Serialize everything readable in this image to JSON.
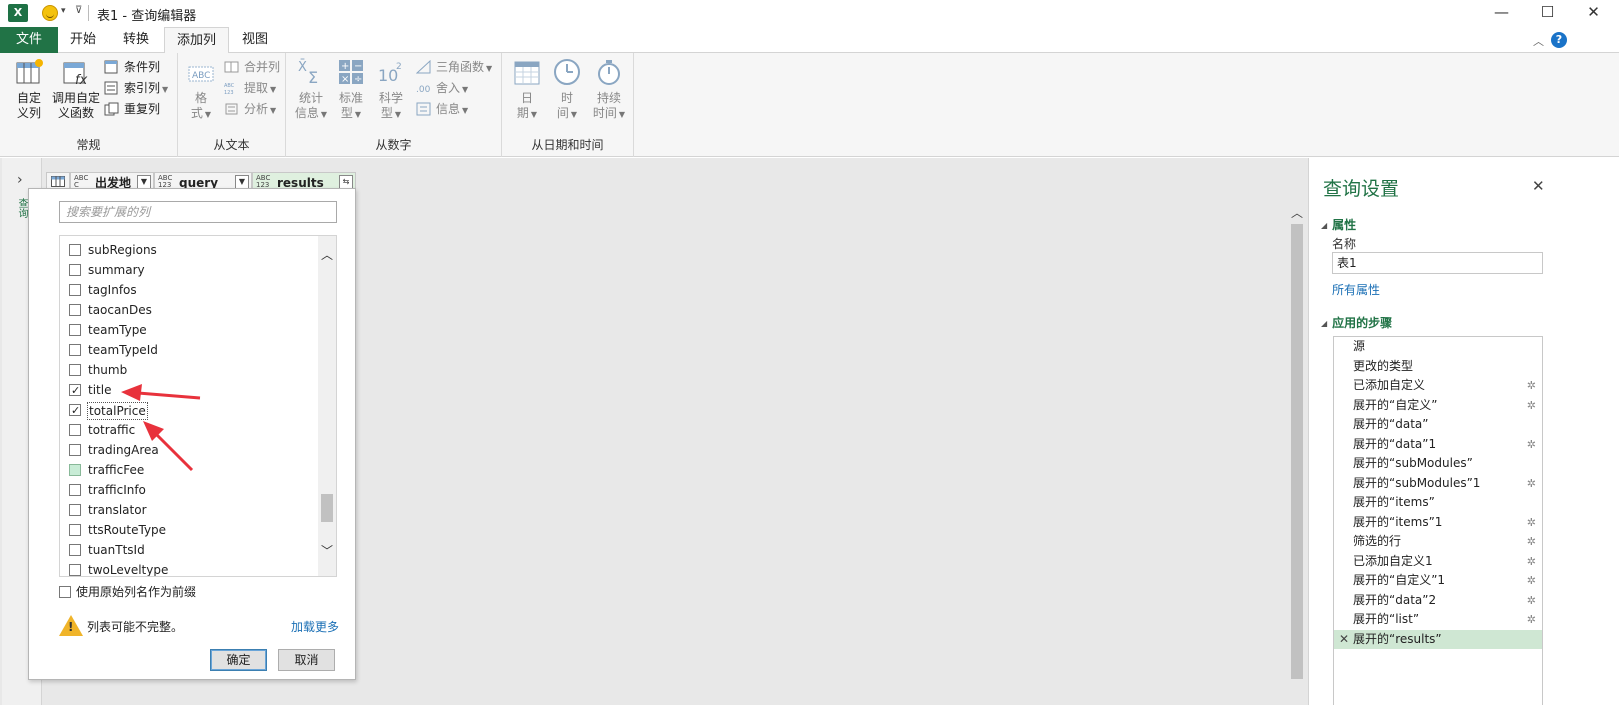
{
  "window": {
    "title": "表1 - 查询编辑器",
    "logo": "X",
    "controls": {
      "minimize": "—",
      "maximize": "☐",
      "close": "✕"
    }
  },
  "tabs": [
    {
      "label": "文件"
    },
    {
      "label": "开始"
    },
    {
      "label": "转换"
    },
    {
      "label": "添加列"
    },
    {
      "label": "视图"
    }
  ],
  "ribbon": {
    "general": {
      "label": "常规",
      "custom_column": "自定\n义列",
      "invoke_custom_function": "调用自定\n义函数",
      "conditional_column": "条件列",
      "index_column": "索引列",
      "duplicate_column": "重复列"
    },
    "from_text": {
      "label": "从文本",
      "format": "格\n式",
      "merge_columns": "合并列",
      "extract": "提取",
      "parse": "分析"
    },
    "from_number": {
      "label": "从数字",
      "statistics": "统计\n信息",
      "standard": "标准\n型",
      "scientific": "科学\n型",
      "trigonometry": "三角函数",
      "rounding": "舍入",
      "information": "信息"
    },
    "from_datetime": {
      "label": "从日期和时间",
      "date": "日\n期",
      "time": "时\n间",
      "duration": "持续\n时间"
    }
  },
  "columns": [
    {
      "type": "ABC\nC",
      "name": "出发地"
    },
    {
      "type": "ABC\n123",
      "name": "query"
    },
    {
      "type": "ABC\n123",
      "name": "results"
    }
  ],
  "left_strip": {
    "label": "查询"
  },
  "expand_popup": {
    "search_placeholder": "搜索要扩展的列",
    "items": [
      {
        "label": "subRegions",
        "checked": false
      },
      {
        "label": "summary",
        "checked": false
      },
      {
        "label": "tagInfos",
        "checked": false
      },
      {
        "label": "taocanDes",
        "checked": false
      },
      {
        "label": "teamType",
        "checked": false
      },
      {
        "label": "teamTypeId",
        "checked": false
      },
      {
        "label": "thumb",
        "checked": false
      },
      {
        "label": "title",
        "checked": true
      },
      {
        "label": "totalPrice",
        "checked": true
      },
      {
        "label": "totraffic",
        "checked": false
      },
      {
        "label": "tradingArea",
        "checked": false
      },
      {
        "label": "trafficFee",
        "checked": false
      },
      {
        "label": "trafficInfo",
        "checked": false
      },
      {
        "label": "translator",
        "checked": false
      },
      {
        "label": "ttsRouteType",
        "checked": false
      },
      {
        "label": "tuanTtsId",
        "checked": false
      },
      {
        "label": "twoLeveltype",
        "checked": false
      }
    ],
    "use_prefix_label": "使用原始列名作为前缀",
    "warning_text": "列表可能不完整。",
    "load_more": "加载更多",
    "ok": "确定",
    "cancel": "取消"
  },
  "query_settings": {
    "title": "查询设置",
    "properties_header": "属性",
    "name_label": "名称",
    "name_value": "表1",
    "all_properties": "所有属性",
    "applied_steps_header": "应用的步骤",
    "steps": [
      {
        "label": "源",
        "gear": false
      },
      {
        "label": "更改的类型",
        "gear": false
      },
      {
        "label": "已添加自定义",
        "gear": true
      },
      {
        "label": "展开的“自定义”",
        "gear": true
      },
      {
        "label": "展开的“data”",
        "gear": false
      },
      {
        "label": "展开的“data”1",
        "gear": true
      },
      {
        "label": "展开的“subModules”",
        "gear": false
      },
      {
        "label": "展开的“subModules”1",
        "gear": true
      },
      {
        "label": "展开的“items”",
        "gear": false
      },
      {
        "label": "展开的“items”1",
        "gear": true
      },
      {
        "label": "筛选的行",
        "gear": true
      },
      {
        "label": "已添加自定义1",
        "gear": true
      },
      {
        "label": "展开的“自定义”1",
        "gear": true
      },
      {
        "label": "展开的“data”2",
        "gear": true
      },
      {
        "label": "展开的“list”",
        "gear": true
      },
      {
        "label": "展开的“results”",
        "gear": false,
        "selected": true
      }
    ]
  },
  "colors": {
    "accent": "#217346",
    "link": "#1a6fb5",
    "annotation_arrow": "#e8323c"
  }
}
